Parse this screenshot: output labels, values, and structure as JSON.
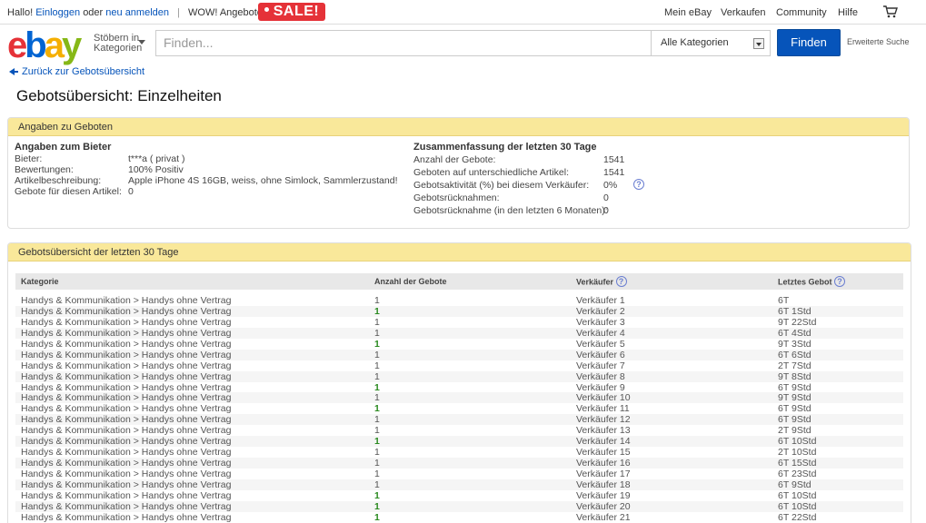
{
  "topbar": {
    "greeting": "Hallo!",
    "login": "Einloggen",
    "or": "oder",
    "register": "neu anmelden",
    "wow": "WOW! Angebote",
    "sale": "SALE!",
    "nav": [
      "Mein eBay",
      "Verkaufen",
      "Community",
      "Hilfe"
    ]
  },
  "header": {
    "browse_line1": "Stöbern in",
    "browse_line2": "Kategorien",
    "search_placeholder": "Finden...",
    "category": "Alle Kategorien",
    "find": "Finden",
    "advanced": "Erweiterte Suche"
  },
  "back_link": "Zurück zur Gebotsübersicht",
  "page_title": "Gebotsübersicht: Einzelheiten",
  "panel1": {
    "title": "Angaben zu Geboten",
    "bidder_title": "Angaben zum Bieter",
    "bidder": [
      {
        "label": "Bieter:",
        "value": "t***a  ( privat )"
      },
      {
        "label": "Bewertungen:",
        "value": "100% Positiv"
      },
      {
        "label": "Artikelbeschreibung:",
        "value": "Apple iPhone 4S 16GB, weiss, ohne Simlock, Sammlerzustand!"
      },
      {
        "label": "Gebote für diesen Artikel:",
        "value": "0"
      }
    ],
    "summary_title": "Zusammenfassung der letzten 30 Tage",
    "summary": [
      {
        "label": "Anzahl der Gebote:",
        "value": "1541"
      },
      {
        "label": "Geboten auf unterschiedliche Artikel:",
        "value": "1541"
      },
      {
        "label": "Gebotsaktivität (%) bei diesem Verkäufer:",
        "value": "0%"
      },
      {
        "label": "Gebotsrücknahmen:",
        "value": "0"
      },
      {
        "label": "Gebotsrücknahme (in den letzten 6 Monaten):",
        "value": "0"
      }
    ]
  },
  "panel2": {
    "title": "Gebotsübersicht der letzten 30 Tage",
    "headers": [
      "Kategorie",
      "Anzahl der Gebote",
      "Verkäufer",
      "Letztes Gebot"
    ],
    "rows": [
      {
        "cat": "Handys & Kommunikation > Handys ohne Vertrag",
        "bids": "1",
        "green": false,
        "seller": "Verkäufer 1",
        "last": "6T"
      },
      {
        "cat": "Handys & Kommunikation > Handys ohne Vertrag",
        "bids": "1",
        "green": true,
        "seller": "Verkäufer 2",
        "last": "6T 1Std"
      },
      {
        "cat": "Handys & Kommunikation > Handys ohne Vertrag",
        "bids": "1",
        "green": false,
        "seller": "Verkäufer 3",
        "last": "9T 22Std"
      },
      {
        "cat": "Handys & Kommunikation > Handys ohne Vertrag",
        "bids": "1",
        "green": false,
        "seller": "Verkäufer 4",
        "last": "6T 4Std"
      },
      {
        "cat": "Handys & Kommunikation > Handys ohne Vertrag",
        "bids": "1",
        "green": true,
        "seller": "Verkäufer 5",
        "last": "9T 3Std"
      },
      {
        "cat": "Handys & Kommunikation > Handys ohne Vertrag",
        "bids": "1",
        "green": false,
        "seller": "Verkäufer 6",
        "last": "6T 6Std"
      },
      {
        "cat": "Handys & Kommunikation > Handys ohne Vertrag",
        "bids": "1",
        "green": false,
        "seller": "Verkäufer 7",
        "last": "2T 7Std"
      },
      {
        "cat": "Handys & Kommunikation > Handys ohne Vertrag",
        "bids": "1",
        "green": false,
        "seller": "Verkäufer 8",
        "last": "9T 8Std"
      },
      {
        "cat": "Handys & Kommunikation > Handys ohne Vertrag",
        "bids": "1",
        "green": true,
        "seller": "Verkäufer 9",
        "last": "6T 9Std"
      },
      {
        "cat": "Handys & Kommunikation > Handys ohne Vertrag",
        "bids": "1",
        "green": false,
        "seller": "Verkäufer 10",
        "last": "9T 9Std"
      },
      {
        "cat": "Handys & Kommunikation > Handys ohne Vertrag",
        "bids": "1",
        "green": true,
        "seller": "Verkäufer 11",
        "last": "6T 9Std"
      },
      {
        "cat": "Handys & Kommunikation > Handys ohne Vertrag",
        "bids": "1",
        "green": false,
        "seller": "Verkäufer 12",
        "last": "6T 9Std"
      },
      {
        "cat": "Handys & Kommunikation > Handys ohne Vertrag",
        "bids": "1",
        "green": false,
        "seller": "Verkäufer 13",
        "last": "2T 9Std"
      },
      {
        "cat": "Handys & Kommunikation > Handys ohne Vertrag",
        "bids": "1",
        "green": true,
        "seller": "Verkäufer 14",
        "last": "6T 10Std"
      },
      {
        "cat": "Handys & Kommunikation > Handys ohne Vertrag",
        "bids": "1",
        "green": false,
        "seller": "Verkäufer 15",
        "last": "2T 10Std"
      },
      {
        "cat": "Handys & Kommunikation > Handys ohne Vertrag",
        "bids": "1",
        "green": false,
        "seller": "Verkäufer 16",
        "last": "6T 15Std"
      },
      {
        "cat": "Handys & Kommunikation > Handys ohne Vertrag",
        "bids": "1",
        "green": false,
        "seller": "Verkäufer 17",
        "last": "6T 23Std"
      },
      {
        "cat": "Handys & Kommunikation > Handys ohne Vertrag",
        "bids": "1",
        "green": false,
        "seller": "Verkäufer 18",
        "last": "6T 9Std"
      },
      {
        "cat": "Handys & Kommunikation > Handys ohne Vertrag",
        "bids": "1",
        "green": true,
        "seller": "Verkäufer 19",
        "last": "6T 10Std"
      },
      {
        "cat": "Handys & Kommunikation > Handys ohne Vertrag",
        "bids": "1",
        "green": true,
        "seller": "Verkäufer 20",
        "last": "6T 10Std"
      },
      {
        "cat": "Handys & Kommunikation > Handys ohne Vertrag",
        "bids": "1",
        "green": true,
        "seller": "Verkäufer 21",
        "last": "6T 22Std"
      }
    ]
  }
}
